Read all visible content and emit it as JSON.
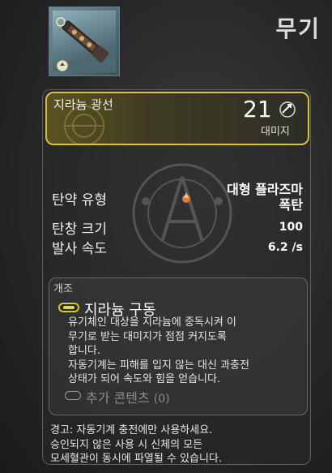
{
  "header": {
    "title": "무기"
  },
  "weapon": {
    "name": "지라늄 광선",
    "damage_value": "21",
    "damage_label": "대미지"
  },
  "stats": [
    {
      "label": "탄약 유형",
      "value_line1": "대형 플라즈마",
      "value_line2": "폭탄",
      "icon": "ammo-plasma-icon"
    },
    {
      "label": "탄창 크기",
      "value": "100"
    },
    {
      "label": "발사 속도",
      "value": "6.2 /s"
    }
  ],
  "mod": {
    "header": "개조",
    "name": "지라늄 구동",
    "desc_lines": [
      "유기체인 대상을 지라늄에 중독시켜 이",
      "무기로 받는 대미지가 점점 커지도록",
      "합니다.",
      "자동기계는 피해를 입지 않는 대신 과충전",
      "상태가 되어 속도와 힘을 얻습니다."
    ],
    "extra_label": "추가 콘텐츠",
    "extra_count": "(0)"
  },
  "warning_lines": [
    "경고: 자동기계 충전에만 사용하세요.",
    "승인되지 않은 사용 시 신체의 모든",
    "모세혈관이 동시에 파열될 수 있습니다."
  ],
  "colors": {
    "accent": "#d9c23c",
    "panel_border": "#5e5e5e",
    "muted_text": "#8c8c8c"
  }
}
